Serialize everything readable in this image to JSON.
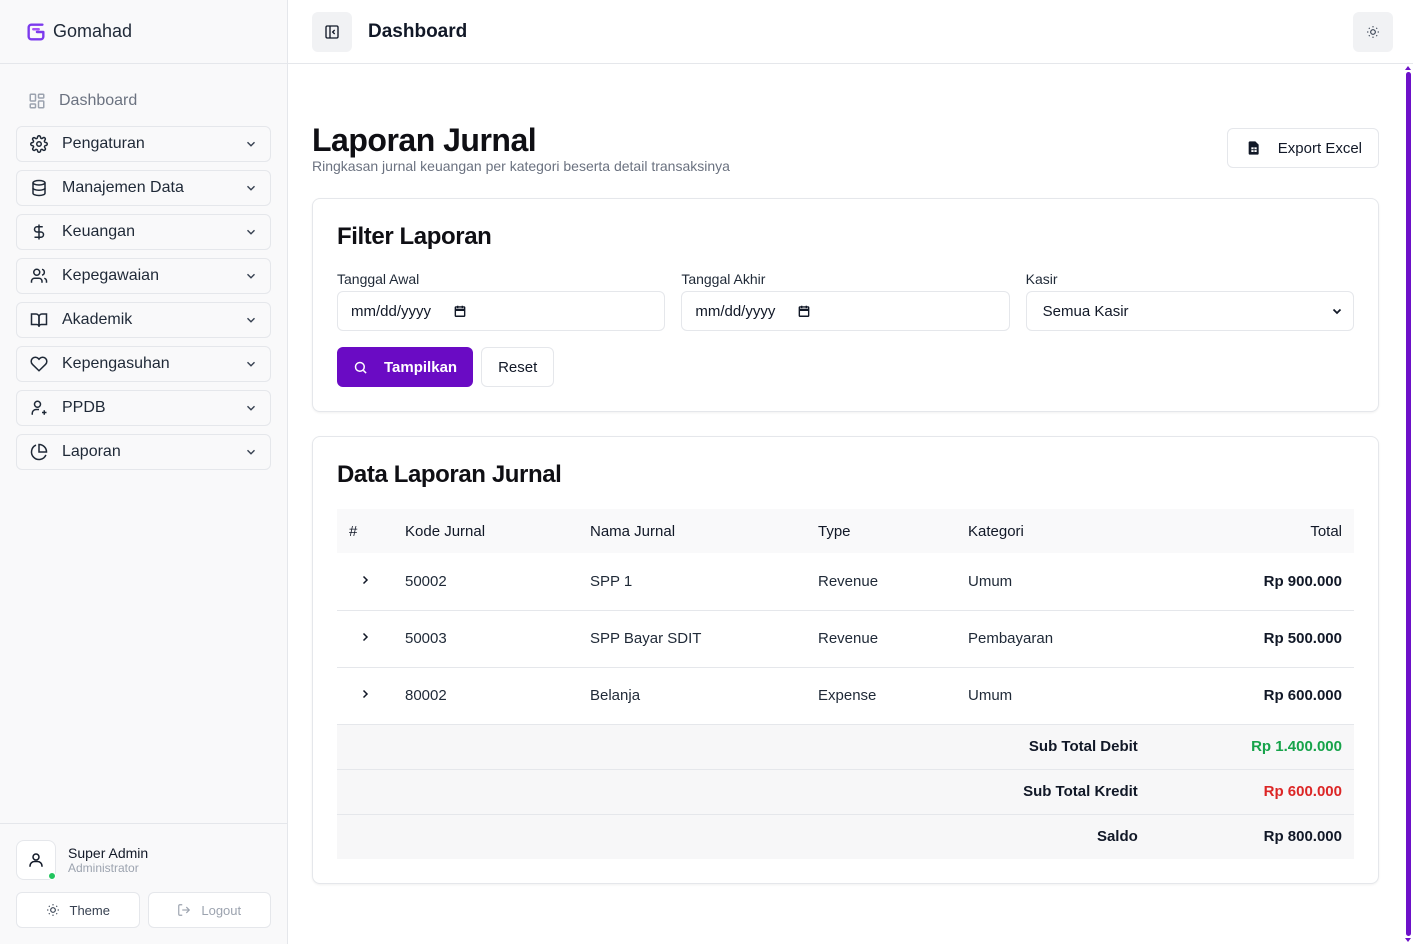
{
  "brand": {
    "name": "Gomahad",
    "icon": "brand-logo-icon",
    "accent": "#6a0bc4"
  },
  "sidebar": {
    "dashboard": {
      "label": "Dashboard",
      "icon": "grid-icon"
    },
    "items": [
      {
        "label": "Pengaturan",
        "icon": "gear-icon"
      },
      {
        "label": "Manajemen Data",
        "icon": "database-icon"
      },
      {
        "label": "Keuangan",
        "icon": "dollar-icon"
      },
      {
        "label": "Kepegawaian",
        "icon": "users-icon"
      },
      {
        "label": "Akademik",
        "icon": "book-icon"
      },
      {
        "label": "Kepengasuhan",
        "icon": "heart-icon"
      },
      {
        "label": "PPDB",
        "icon": "user-plus-icon"
      },
      {
        "label": "Laporan",
        "icon": "pie-chart-icon"
      }
    ]
  },
  "user": {
    "name": "Super Admin",
    "role": "Administrator",
    "status_color": "#22c55e",
    "theme_label": "Theme",
    "logout_label": "Logout"
  },
  "topbar": {
    "title": "Dashboard"
  },
  "page": {
    "title": "Laporan Jurnal",
    "subtitle": "Ringkasan jurnal keuangan per kategori beserta detail transaksinya",
    "export_label": "Export Excel"
  },
  "filter": {
    "title": "Filter Laporan",
    "start_label": "Tanggal Awal",
    "start_value": "mm/dd/yyyy",
    "end_label": "Tanggal Akhir",
    "end_value": "mm/dd/yyyy",
    "cashier_label": "Kasir",
    "cashier_value": "Semua Kasir",
    "show_label": "Tampilkan",
    "reset_label": "Reset"
  },
  "report": {
    "title": "Data Laporan Jurnal",
    "columns": [
      "#",
      "Kode Jurnal",
      "Nama Jurnal",
      "Type",
      "Kategori",
      "Total"
    ],
    "rows": [
      {
        "code": "50002",
        "name": "SPP 1",
        "type": "Revenue",
        "category": "Umum",
        "total": "Rp 900.000"
      },
      {
        "code": "50003",
        "name": "SPP Bayar SDIT",
        "type": "Revenue",
        "category": "Pembayaran",
        "total": "Rp 500.000"
      },
      {
        "code": "80002",
        "name": "Belanja",
        "type": "Expense",
        "category": "Umum",
        "total": "Rp 600.000"
      }
    ],
    "summary": {
      "debit_label": "Sub Total Debit",
      "debit_value": "Rp 1.400.000",
      "credit_label": "Sub Total Kredit",
      "credit_value": "Rp 600.000",
      "balance_label": "Saldo",
      "balance_value": "Rp 800.000"
    }
  }
}
